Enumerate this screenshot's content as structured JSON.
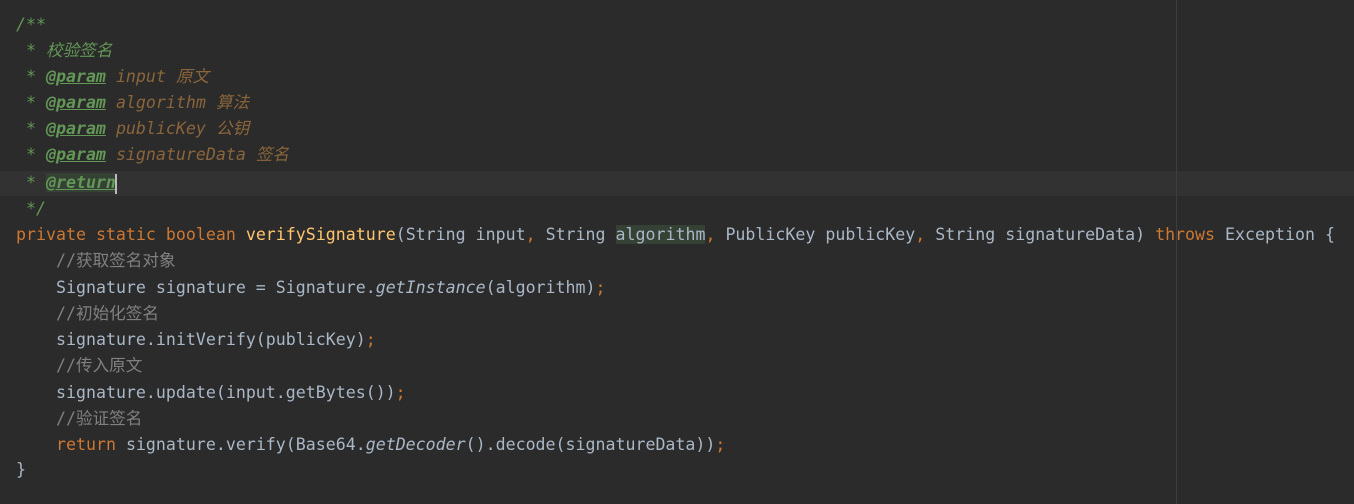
{
  "editor": {
    "javadoc": {
      "open": "/**",
      "summary_prefix": " * ",
      "summary": "校验签名",
      "params": [
        {
          "tag": "@param",
          "name": "input",
          "desc": "原文"
        },
        {
          "tag": "@param",
          "name": "algorithm",
          "desc": "算法"
        },
        {
          "tag": "@param",
          "name": "publicKey",
          "desc": "公钥"
        },
        {
          "tag": "@param",
          "name": "signatureData",
          "desc": "签名"
        }
      ],
      "return_tag": "@return",
      "close": " */"
    },
    "signature": {
      "kw_private": "private",
      "kw_static": "static",
      "kw_boolean": "boolean",
      "method_name": "verifySignature",
      "p1_type": "String",
      "p1_name": "input",
      "p2_type": "String",
      "p2_name": "algorithm",
      "p3_type": "PublicKey",
      "p3_name": "publicKey",
      "p4_type": "String",
      "p4_name": "signatureData",
      "kw_throws": "throws",
      "exception": "Exception",
      "open_brace": "{"
    },
    "body": {
      "c1": "//获取签名对象",
      "l1_a": "Signature signature = Signature.",
      "l1_b": "getInstance",
      "l1_c": "(algorithm)",
      "c2": "//初始化签名",
      "l2": "signature.initVerify(publicKey)",
      "c3": "//传入原文",
      "l3": "signature.update(input.getBytes())",
      "c4": "//验证签名",
      "kw_return": "return",
      "l4_a": " signature.verify(Base64.",
      "l4_b": "getDecoder",
      "l4_c": "().decode(signatureData))",
      "semicolon": ";"
    },
    "close_brace": "}"
  }
}
